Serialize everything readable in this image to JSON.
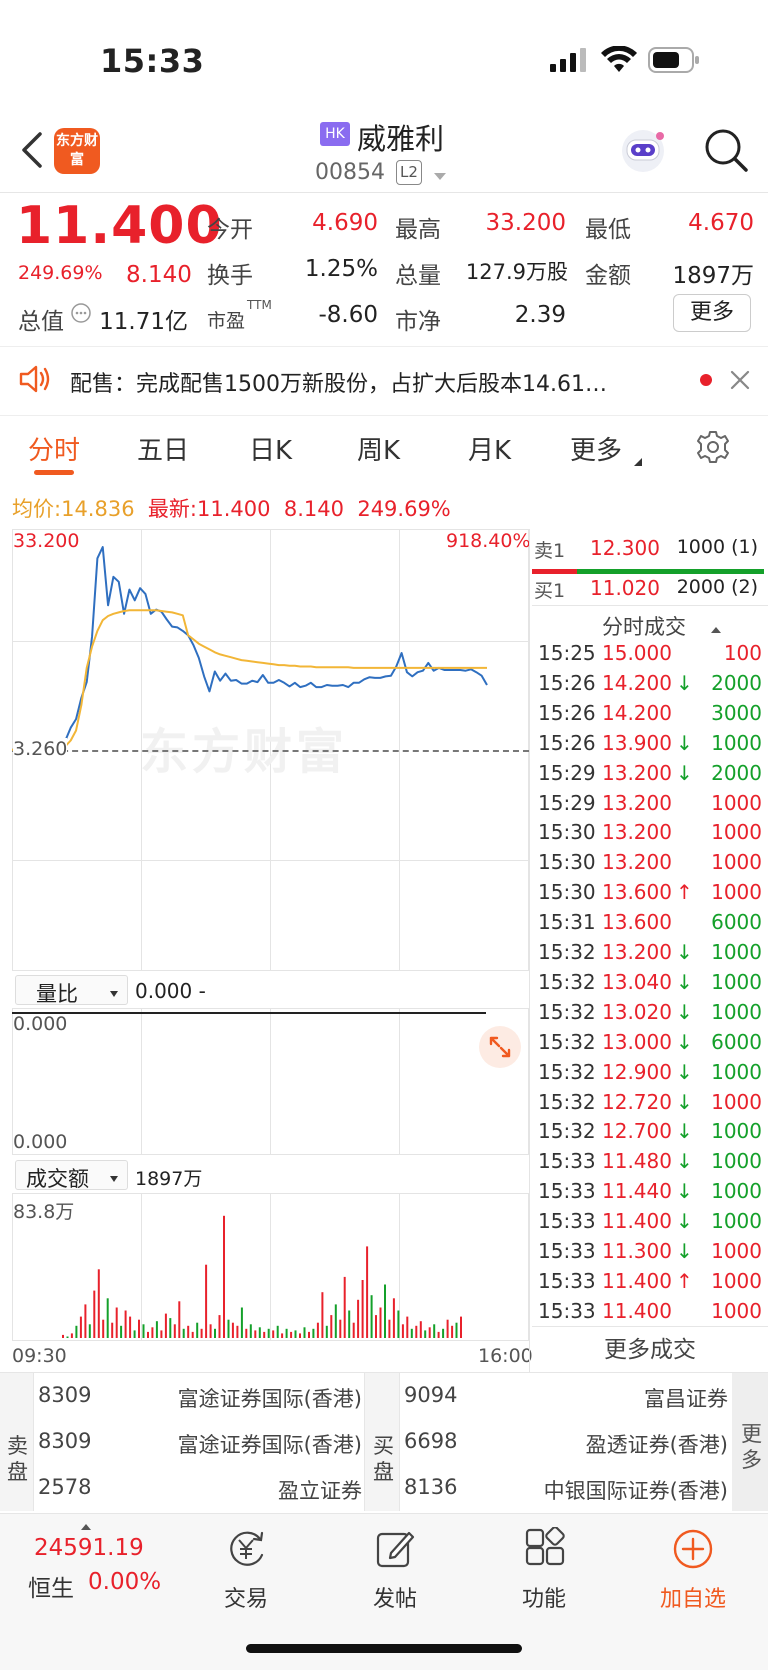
{
  "status_bar": {
    "time": "15:33"
  },
  "header": {
    "logo_text": "东方财富",
    "market_badge": "HK",
    "stock_name": "威雅利",
    "stock_code": "00854",
    "level_badge": "L2"
  },
  "quote": {
    "price": "11.400",
    "change_pct": "249.69%",
    "change": "8.140",
    "fields": {
      "open_label": "今开",
      "open": "4.690",
      "high_label": "最高",
      "high": "33.200",
      "low_label": "最低",
      "low": "4.670",
      "turnover_label": "换手",
      "turnover": "1.25%",
      "volume_label": "总量",
      "volume": "127.9万股",
      "amount_label": "金额",
      "amount": "1897万",
      "mktcap_label": "总值",
      "mktcap": "11.71亿",
      "pe_label": "市盈",
      "pe_sup": "TTM",
      "pe": "-8.60",
      "pb_label": "市净",
      "pb": "2.39"
    },
    "more_button": "更多"
  },
  "notice": {
    "text": "配售：完成配售1500万新股份，占扩大后股本14.61…"
  },
  "tabs": [
    "分时",
    "五日",
    "日K",
    "周K",
    "月K",
    "更多"
  ],
  "info_line": {
    "avg_label": "均价:",
    "avg": "14.836",
    "latest_label": "最新:",
    "latest": "11.400",
    "change": "8.140",
    "change_pct": "249.69%"
  },
  "chart_data": {
    "type": "line",
    "price_high_label": "33.200",
    "pct_high_label": "918.40%",
    "prev_close_label": "3.260",
    "x_start": "09:30",
    "x_end": "16:00",
    "price_range": [
      3.26,
      33.2
    ],
    "prev_close": 3.26,
    "series": [
      {
        "name": "price",
        "color": "#2f6fc0",
        "values": [
          3.3,
          3.3,
          3.3,
          3.3,
          3.3,
          3.4,
          3.3,
          3.4,
          3.5,
          3.7,
          4.6,
          6.4,
          7.6,
          10.6,
          12.8,
          19.2,
          30.2,
          31.8,
          23.6,
          27.6,
          26.9,
          22.4,
          25.8,
          24.3,
          26.0,
          25.2,
          22.4,
          23.0,
          22.7,
          21.6,
          20.6,
          20.5,
          20.0,
          19.4,
          18.0,
          16.2,
          13.6,
          11.5,
          14.3,
          13.0,
          14.0,
          13.0,
          13.1,
          12.6,
          12.6,
          13.0,
          12.8,
          13.8,
          12.7,
          12.7,
          13.1,
          12.7,
          12.2,
          12.7,
          12.1,
          12.3,
          12.7,
          12.1,
          12.1,
          12.4,
          12.3,
          12.3,
          12.4,
          12.1,
          12.7,
          12.7,
          13.2,
          13.5,
          13.4,
          13.4,
          13.6,
          13.7,
          15.0,
          16.9,
          14.2,
          13.6,
          14.2,
          14.4,
          15.5,
          14.4,
          14.8,
          14.5,
          14.5,
          14.5,
          14.5,
          14.4,
          14.6,
          14.2,
          13.7,
          12.4
        ]
      },
      {
        "name": "avg",
        "color": "#f2b637",
        "values": [
          3.3,
          3.3,
          3.3,
          3.3,
          3.3,
          3.35,
          3.35,
          3.38,
          3.42,
          3.5,
          3.8,
          4.6,
          6.0,
          9.6,
          14.8,
          17.8,
          20.0,
          21.5,
          22.1,
          22.4,
          22.6,
          22.8,
          22.9,
          22.9,
          22.9,
          22.9,
          22.9,
          22.9,
          22.8,
          22.7,
          22.6,
          22.4,
          22.2,
          19.4,
          18.8,
          18.2,
          17.8,
          17.4,
          17.0,
          16.7,
          16.5,
          16.3,
          16.1,
          15.9,
          15.8,
          15.7,
          15.6,
          15.5,
          15.4,
          15.3,
          15.2,
          15.2,
          15.1,
          15.1,
          15.0,
          15.0,
          15.0,
          14.9,
          14.9,
          14.9,
          14.9,
          14.9,
          14.9,
          14.9,
          14.8,
          14.8,
          14.8,
          14.8,
          14.8,
          14.8,
          14.8,
          14.8,
          14.8,
          14.8,
          14.8,
          14.8,
          14.8,
          14.8,
          14.8,
          14.8,
          14.8,
          14.8,
          14.8,
          14.8,
          14.8,
          14.8,
          14.8,
          14.8,
          14.8,
          14.8
        ]
      }
    ],
    "volume_max_label": "83.8万",
    "volume_max": 83.8,
    "volume_bars": [
      {
        "v": 2,
        "c": "r"
      },
      {
        "v": 1,
        "c": "g"
      },
      {
        "v": 3,
        "c": "r"
      },
      {
        "v": 8,
        "c": "g"
      },
      {
        "v": 14,
        "c": "r"
      },
      {
        "v": 22,
        "c": "r"
      },
      {
        "v": 9,
        "c": "g"
      },
      {
        "v": 31,
        "c": "r"
      },
      {
        "v": 45,
        "c": "r"
      },
      {
        "v": 12,
        "c": "r"
      },
      {
        "v": 26,
        "c": "g"
      },
      {
        "v": 10,
        "c": "r"
      },
      {
        "v": 20,
        "c": "r"
      },
      {
        "v": 8,
        "c": "g"
      },
      {
        "v": 18,
        "c": "r"
      },
      {
        "v": 14,
        "c": "r"
      },
      {
        "v": 5,
        "c": "g"
      },
      {
        "v": 12,
        "c": "r"
      },
      {
        "v": 9,
        "c": "g"
      },
      {
        "v": 4,
        "c": "r"
      },
      {
        "v": 7,
        "c": "r"
      },
      {
        "v": 11,
        "c": "g"
      },
      {
        "v": 5,
        "c": "r"
      },
      {
        "v": 16,
        "c": "r"
      },
      {
        "v": 13,
        "c": "g"
      },
      {
        "v": 9,
        "c": "r"
      },
      {
        "v": 24,
        "c": "r"
      },
      {
        "v": 6,
        "c": "g"
      },
      {
        "v": 8,
        "c": "r"
      },
      {
        "v": 4,
        "c": "r"
      },
      {
        "v": 10,
        "c": "g"
      },
      {
        "v": 6,
        "c": "r"
      },
      {
        "v": 48,
        "c": "r"
      },
      {
        "v": 9,
        "c": "r"
      },
      {
        "v": 6,
        "c": "g"
      },
      {
        "v": 15,
        "c": "r"
      },
      {
        "v": 80,
        "c": "r"
      },
      {
        "v": 12,
        "c": "g"
      },
      {
        "v": 10,
        "c": "r"
      },
      {
        "v": 8,
        "c": "r"
      },
      {
        "v": 20,
        "c": "g"
      },
      {
        "v": 6,
        "c": "r"
      },
      {
        "v": 9,
        "c": "g"
      },
      {
        "v": 5,
        "c": "r"
      },
      {
        "v": 7,
        "c": "g"
      },
      {
        "v": 4,
        "c": "r"
      },
      {
        "v": 6,
        "c": "g"
      },
      {
        "v": 5,
        "c": "r"
      },
      {
        "v": 8,
        "c": "g"
      },
      {
        "v": 3,
        "c": "r"
      },
      {
        "v": 6,
        "c": "g"
      },
      {
        "v": 4,
        "c": "r"
      },
      {
        "v": 5,
        "c": "g"
      },
      {
        "v": 3,
        "c": "r"
      },
      {
        "v": 7,
        "c": "g"
      },
      {
        "v": 4,
        "c": "r"
      },
      {
        "v": 6,
        "c": "g"
      },
      {
        "v": 10,
        "c": "r"
      },
      {
        "v": 30,
        "c": "r"
      },
      {
        "v": 8,
        "c": "g"
      },
      {
        "v": 15,
        "c": "r"
      },
      {
        "v": 22,
        "c": "g"
      },
      {
        "v": 12,
        "c": "r"
      },
      {
        "v": 40,
        "c": "r"
      },
      {
        "v": 18,
        "c": "g"
      },
      {
        "v": 10,
        "c": "r"
      },
      {
        "v": 25,
        "c": "r"
      },
      {
        "v": 38,
        "c": "r"
      },
      {
        "v": 60,
        "c": "r"
      },
      {
        "v": 28,
        "c": "g"
      },
      {
        "v": 15,
        "c": "r"
      },
      {
        "v": 20,
        "c": "r"
      },
      {
        "v": 35,
        "c": "g"
      },
      {
        "v": 12,
        "c": "r"
      },
      {
        "v": 26,
        "c": "r"
      },
      {
        "v": 18,
        "c": "g"
      },
      {
        "v": 9,
        "c": "r"
      },
      {
        "v": 14,
        "c": "r"
      },
      {
        "v": 6,
        "c": "g"
      },
      {
        "v": 8,
        "c": "r"
      },
      {
        "v": 11,
        "c": "r"
      },
      {
        "v": 5,
        "c": "g"
      },
      {
        "v": 7,
        "c": "r"
      },
      {
        "v": 9,
        "c": "g"
      },
      {
        "v": 4,
        "c": "r"
      },
      {
        "v": 6,
        "c": "g"
      },
      {
        "v": 12,
        "c": "r"
      },
      {
        "v": 8,
        "c": "r"
      },
      {
        "v": 10,
        "c": "g"
      },
      {
        "v": 14,
        "c": "r"
      }
    ]
  },
  "volume_ratio": {
    "label": "量比",
    "value": "0.000 -",
    "top_label": "0.000",
    "bottom_label": "0.000"
  },
  "amount_indicator": {
    "label": "成交额",
    "value": "1897万"
  },
  "order_book": {
    "ask_label": "卖1",
    "ask_price": "12.300",
    "ask_vol": "1000 (1)",
    "bid_label": "买1",
    "bid_price": "11.020",
    "bid_vol": "2000 (2)"
  },
  "trades": {
    "title": "分时成交",
    "more": "更多成交",
    "rows": [
      {
        "time": "15:25",
        "price": "15.000",
        "arrow": "",
        "vol": "100",
        "c": "r"
      },
      {
        "time": "15:26",
        "price": "14.200",
        "arrow": "↓",
        "vol": "2000",
        "c": "g"
      },
      {
        "time": "15:26",
        "price": "14.200",
        "arrow": "",
        "vol": "3000",
        "c": "g"
      },
      {
        "time": "15:26",
        "price": "13.900",
        "arrow": "↓",
        "vol": "1000",
        "c": "g"
      },
      {
        "time": "15:29",
        "price": "13.200",
        "arrow": "↓",
        "vol": "2000",
        "c": "g"
      },
      {
        "time": "15:29",
        "price": "13.200",
        "arrow": "",
        "vol": "1000",
        "c": "r"
      },
      {
        "time": "15:30",
        "price": "13.200",
        "arrow": "",
        "vol": "1000",
        "c": "r"
      },
      {
        "time": "15:30",
        "price": "13.200",
        "arrow": "",
        "vol": "1000",
        "c": "r"
      },
      {
        "time": "15:30",
        "price": "13.600",
        "arrow": "↑",
        "vol": "1000",
        "c": "r"
      },
      {
        "time": "15:31",
        "price": "13.600",
        "arrow": "",
        "vol": "6000",
        "c": "g"
      },
      {
        "time": "15:32",
        "price": "13.200",
        "arrow": "↓",
        "vol": "1000",
        "c": "g"
      },
      {
        "time": "15:32",
        "price": "13.040",
        "arrow": "↓",
        "vol": "1000",
        "c": "g"
      },
      {
        "time": "15:32",
        "price": "13.020",
        "arrow": "↓",
        "vol": "1000",
        "c": "g"
      },
      {
        "time": "15:32",
        "price": "13.000",
        "arrow": "↓",
        "vol": "6000",
        "c": "g"
      },
      {
        "time": "15:32",
        "price": "12.900",
        "arrow": "↓",
        "vol": "1000",
        "c": "g"
      },
      {
        "time": "15:32",
        "price": "12.720",
        "arrow": "↓",
        "vol": "1000",
        "c": "r"
      },
      {
        "time": "15:32",
        "price": "12.700",
        "arrow": "↓",
        "vol": "1000",
        "c": "g"
      },
      {
        "time": "15:33",
        "price": "11.480",
        "arrow": "↓",
        "vol": "1000",
        "c": "g"
      },
      {
        "time": "15:33",
        "price": "11.440",
        "arrow": "↓",
        "vol": "1000",
        "c": "g"
      },
      {
        "time": "15:33",
        "price": "11.400",
        "arrow": "↓",
        "vol": "1000",
        "c": "g"
      },
      {
        "time": "15:33",
        "price": "11.300",
        "arrow": "↓",
        "vol": "1000",
        "c": "r"
      },
      {
        "time": "15:33",
        "price": "11.400",
        "arrow": "↑",
        "vol": "1000",
        "c": "r"
      },
      {
        "time": "15:33",
        "price": "11.400",
        "arrow": "",
        "vol": "1000",
        "c": "r"
      }
    ]
  },
  "brokers": {
    "sell_label": "卖盘",
    "buy_label": "买盘",
    "more_label": "更多",
    "sell": [
      {
        "code": "8309",
        "name": "富途证券国际(香港)"
      },
      {
        "code": "8309",
        "name": "富途证券国际(香港)"
      },
      {
        "code": "2578",
        "name": "盈立证券"
      }
    ],
    "buy": [
      {
        "code": "9094",
        "name": "富昌证券"
      },
      {
        "code": "6698",
        "name": "盈透证券(香港)"
      },
      {
        "code": "8136",
        "name": "中银国际证券(香港)"
      }
    ]
  },
  "bottom_nav": {
    "index_value": "24591.19",
    "index_name": "恒生",
    "index_pct": "0.00%",
    "items": [
      "交易",
      "发帖",
      "功能",
      "加自选"
    ]
  },
  "watermark": "东方财富",
  "colors": {
    "accent": "#f05a20",
    "up": "#e8212b",
    "down": "#14a02a",
    "price_line": "#2f6fc0",
    "avg_line": "#f2b637"
  }
}
